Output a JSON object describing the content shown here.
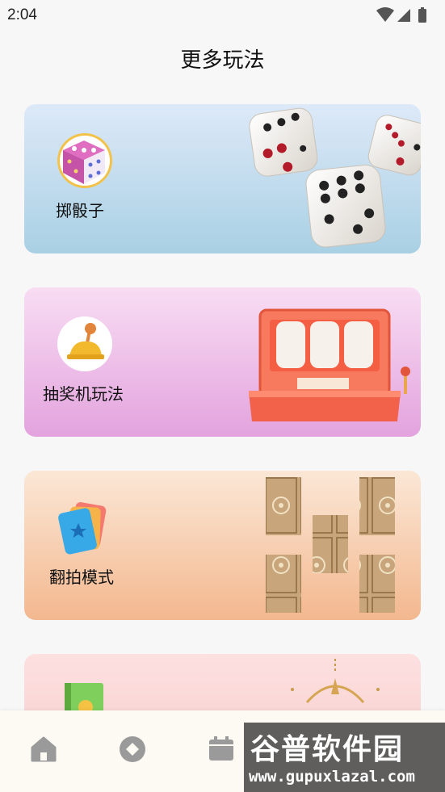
{
  "status": {
    "time": "2:04"
  },
  "header": {
    "title": "更多玩法"
  },
  "cards": [
    {
      "label": "掷骰子"
    },
    {
      "label": "抽奖机玩法"
    },
    {
      "label": "翻拍模式"
    }
  ],
  "tabbar": {
    "items": [
      "home-icon",
      "compass-icon",
      "calendar-icon"
    ]
  },
  "watermark": {
    "title": "谷普软件园",
    "url": "www.gupuxlazal.com"
  }
}
